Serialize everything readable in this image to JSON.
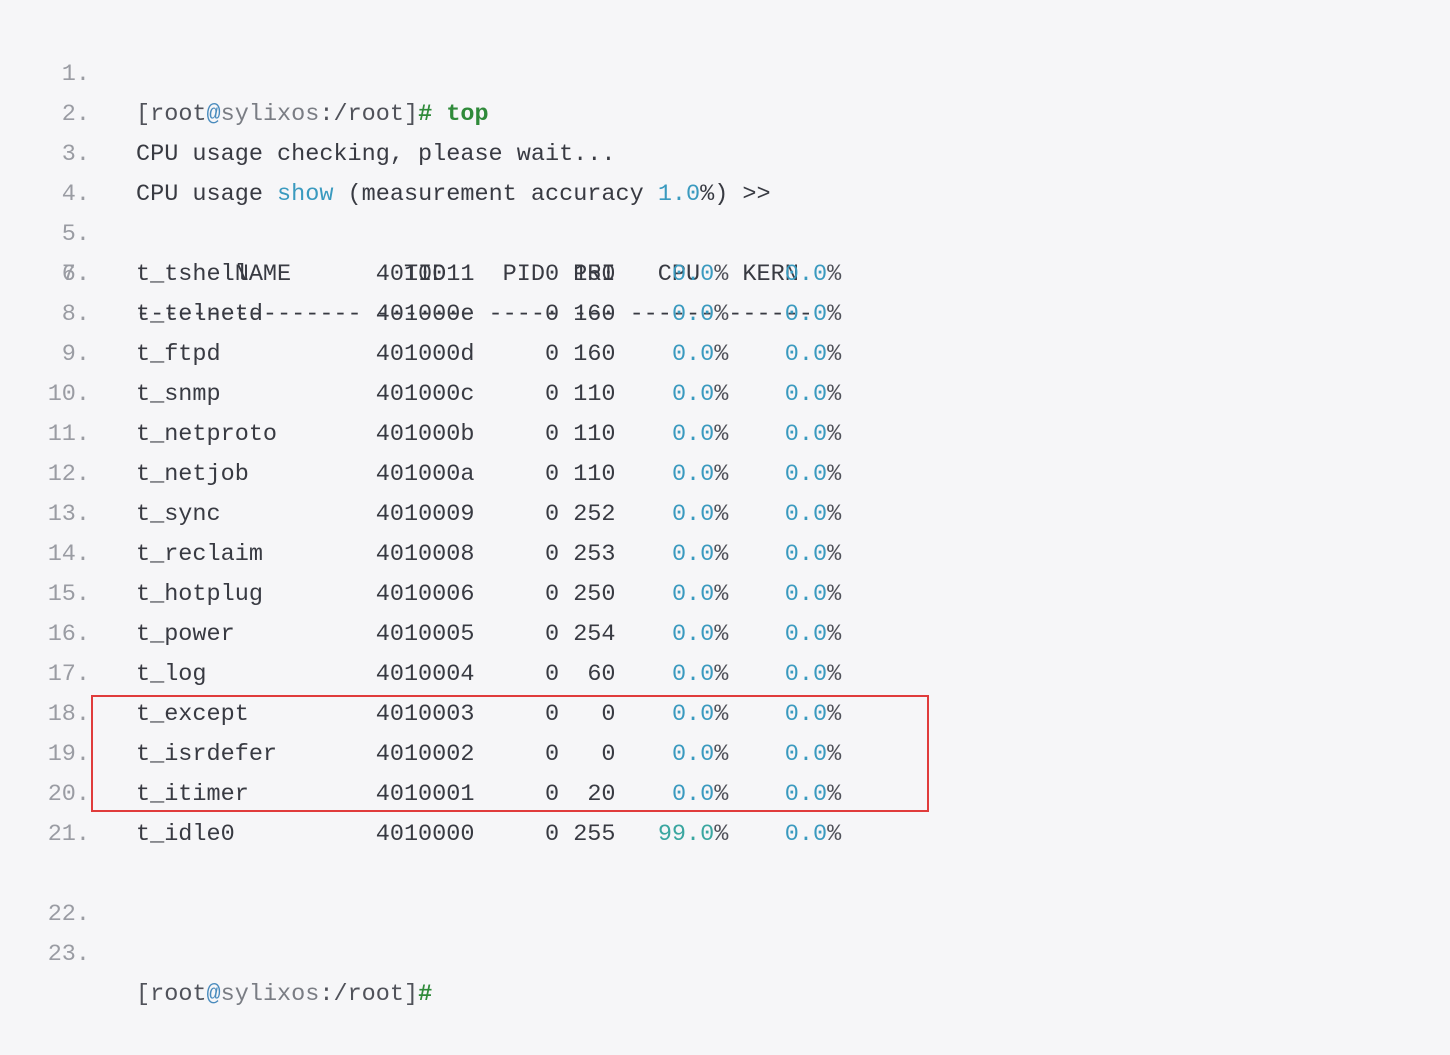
{
  "prompt": {
    "user": "root",
    "at": "@",
    "host": "sylixos",
    "path": ":/root",
    "open": "[",
    "close": "]",
    "hash": "#"
  },
  "lines": {
    "l1_cmd": "top",
    "l2": "CPU usage checking, please wait...",
    "l3_a": "CPU usage ",
    "l3_kw": "show",
    "l3_b": " (measurement accuracy ",
    "l3_num": "1.0",
    "l3_c": "%) >>"
  },
  "line_numbers": [
    "1.",
    "2.",
    "3.",
    "4.",
    "5.",
    "6.",
    "7.",
    "8.",
    "9.",
    "10.",
    "11.",
    "12.",
    "13.",
    "14.",
    "15.",
    "16.",
    "17.",
    "18.",
    "19.",
    "20.",
    "21.",
    "22.",
    "23."
  ],
  "table": {
    "header": "       NAME        TID    PID  PRI   CPU   KERN",
    "rule": "---------------- ------- ----- --- ------ ------",
    "rows": [
      {
        "name": "t_tshell",
        "tid": "4010011",
        "pid": "0",
        "pri": "150",
        "cpu_num": "0.0",
        "kern_num": "0.0"
      },
      {
        "name": "t_telnetd",
        "tid": "401000e",
        "pid": "0",
        "pri": "160",
        "cpu_num": "0.0",
        "kern_num": "0.0"
      },
      {
        "name": "t_ftpd",
        "tid": "401000d",
        "pid": "0",
        "pri": "160",
        "cpu_num": "0.0",
        "kern_num": "0.0"
      },
      {
        "name": "t_snmp",
        "tid": "401000c",
        "pid": "0",
        "pri": "110",
        "cpu_num": "0.0",
        "kern_num": "0.0"
      },
      {
        "name": "t_netproto",
        "tid": "401000b",
        "pid": "0",
        "pri": "110",
        "cpu_num": "0.0",
        "kern_num": "0.0"
      },
      {
        "name": "t_netjob",
        "tid": "401000a",
        "pid": "0",
        "pri": "110",
        "cpu_num": "0.0",
        "kern_num": "0.0"
      },
      {
        "name": "t_sync",
        "tid": "4010009",
        "pid": "0",
        "pri": "252",
        "cpu_num": "0.0",
        "kern_num": "0.0"
      },
      {
        "name": "t_reclaim",
        "tid": "4010008",
        "pid": "0",
        "pri": "253",
        "cpu_num": "0.0",
        "kern_num": "0.0"
      },
      {
        "name": "t_hotplug",
        "tid": "4010006",
        "pid": "0",
        "pri": "250",
        "cpu_num": "0.0",
        "kern_num": "0.0"
      },
      {
        "name": "t_power",
        "tid": "4010005",
        "pid": "0",
        "pri": "254",
        "cpu_num": "0.0",
        "kern_num": "0.0"
      },
      {
        "name": "t_log",
        "tid": "4010004",
        "pid": "0",
        "pri": "60",
        "cpu_num": "0.0",
        "kern_num": "0.0"
      },
      {
        "name": "t_except",
        "tid": "4010003",
        "pid": "0",
        "pri": "0",
        "cpu_num": "0.0",
        "kern_num": "0.0"
      },
      {
        "name": "t_isrdefer",
        "tid": "4010002",
        "pid": "0",
        "pri": "0",
        "cpu_num": "0.0",
        "kern_num": "0.0"
      },
      {
        "name": "t_itimer",
        "tid": "4010001",
        "pid": "0",
        "pri": "20",
        "cpu_num": "0.0",
        "kern_num": "0.0"
      },
      {
        "name": "t_idle0",
        "tid": "4010000",
        "pid": "0",
        "pri": "255",
        "cpu_num": "99.0",
        "kern_num": "0.0"
      }
    ],
    "pct_sign": "%"
  },
  "colors": {
    "highlight_border": "#e03c3c",
    "background": "#f6f6f8",
    "prompt_hash": "#2f8a3a",
    "number": "#3a9abf"
  }
}
